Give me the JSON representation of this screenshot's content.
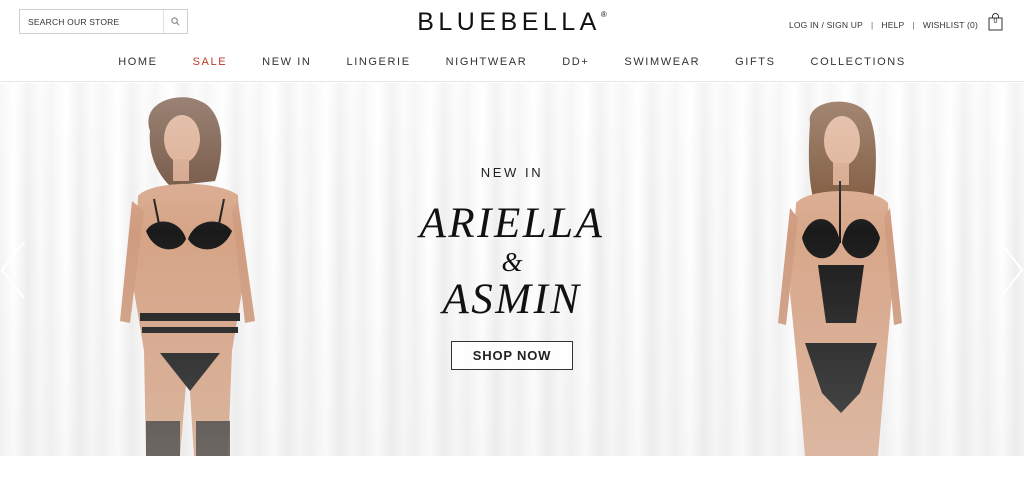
{
  "search": {
    "placeholder": "SEARCH OUR STORE"
  },
  "logo": {
    "text": "BLUEBELLA",
    "mark": "®"
  },
  "account": {
    "login": "LOG IN / SIGN UP",
    "sep1": "|",
    "help": "HELP",
    "sep2": "|",
    "wishlist": "WISHLIST (0)",
    "bag_count": "0"
  },
  "nav": {
    "items": [
      "HOME",
      "SALE",
      "NEW IN",
      "LINGERIE",
      "NIGHTWEAR",
      "DD+",
      "SWIMWEAR",
      "GIFTS",
      "COLLECTIONS"
    ],
    "sale_color": "#c0392b"
  },
  "hero": {
    "eyebrow": "NEW IN",
    "title_line1": "ARIELLA",
    "title_amp": "&",
    "title_line2": "ASMIN",
    "cta": "SHOP NOW"
  },
  "icons": {
    "search": "search-icon",
    "bag": "shopping-bag-icon",
    "prev": "chevron-left-icon",
    "next": "chevron-right-icon"
  }
}
